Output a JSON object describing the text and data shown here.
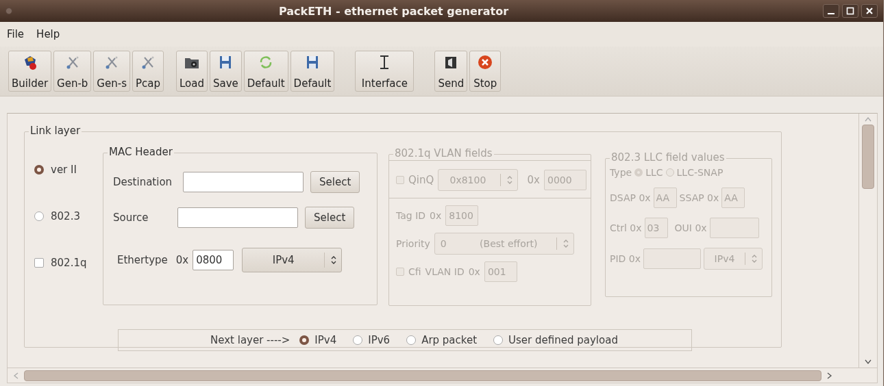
{
  "window": {
    "title": "PackETH - ethernet packet generator"
  },
  "menu": [
    "File",
    "Help"
  ],
  "toolbar": [
    [
      {
        "label": "Builder"
      },
      {
        "label": "Gen-b"
      },
      {
        "label": "Gen-s"
      },
      {
        "label": "Pcap"
      }
    ],
    [
      {
        "label": "Load"
      },
      {
        "label": "Save"
      },
      {
        "label": "Default"
      },
      {
        "label": "Default"
      }
    ],
    [
      {
        "label": "Interface"
      }
    ],
    [
      {
        "label": "Send"
      },
      {
        "label": "Stop"
      }
    ]
  ],
  "link_layer": {
    "title": "Link layer",
    "types": [
      {
        "kind": "radio",
        "label": "ver II",
        "selected": true
      },
      {
        "kind": "radio",
        "label": "802.3",
        "selected": false
      },
      {
        "kind": "checkbox",
        "label": "802.1q",
        "checked": false
      }
    ],
    "mac_header": {
      "title": "MAC Header",
      "destination": {
        "label": "Destination",
        "button": "Select"
      },
      "source": {
        "label": "Source",
        "button": "Select"
      },
      "ethertype": {
        "label": "Ethertype",
        "prefix": "0x",
        "value": "0800",
        "protocol": "IPv4"
      }
    },
    "vlan": {
      "title": "802.1q VLAN fields",
      "disabled": true,
      "qinq": {
        "label": "QinQ",
        "checked": false,
        "tpid": "0x8100",
        "prefix": "0x",
        "value": "0000"
      },
      "tag_id": {
        "label": "Tag ID",
        "prefix": "0x",
        "value": "8100"
      },
      "priority": {
        "label": "Priority",
        "value": "0",
        "meaning": "(Best effort)"
      },
      "cfi": {
        "label": "Cfi",
        "checked": false
      },
      "vlan_id": {
        "label": "VLAN ID",
        "prefix": "0x",
        "value": "001"
      }
    },
    "llc": {
      "title": "802.3 LLC field values",
      "disabled": true,
      "type_label": "Type",
      "types": [
        {
          "label": "LLC",
          "selected": true
        },
        {
          "label": "LLC-SNAP",
          "selected": false
        }
      ],
      "dsap": {
        "label": "DSAP 0x",
        "value": "AA"
      },
      "ssap": {
        "label": "SSAP 0x",
        "value": "AA"
      },
      "ctrl": {
        "label": "Ctrl 0x",
        "value": "03"
      },
      "oui": {
        "label": "OUI 0x"
      },
      "pid": {
        "label": "PID 0x",
        "protocol": "IPv4"
      }
    }
  },
  "next_layer": {
    "label": "Next layer ---->",
    "options": [
      {
        "label": "IPv4",
        "selected": true
      },
      {
        "label": "IPv6",
        "selected": false
      },
      {
        "label": "Arp packet",
        "selected": false
      },
      {
        "label": "User defined payload",
        "selected": false
      }
    ]
  }
}
